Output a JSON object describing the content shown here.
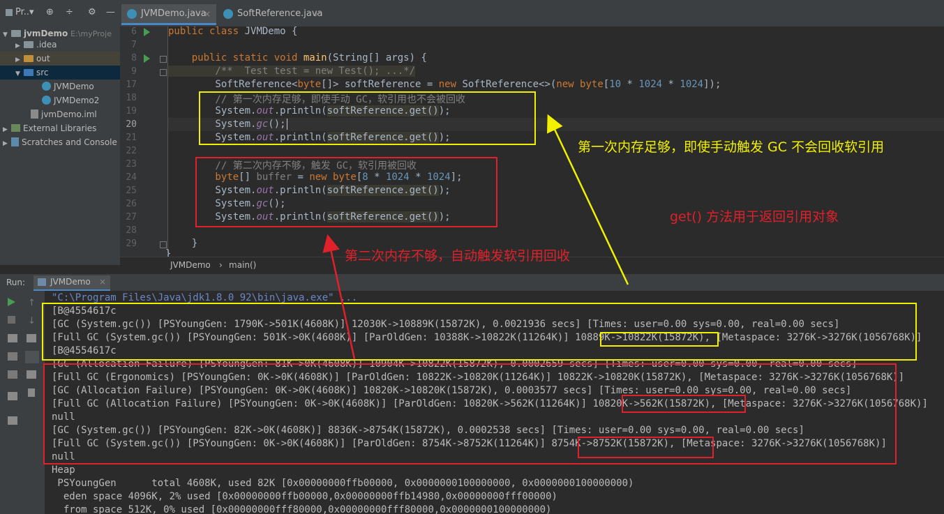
{
  "toolbar": {
    "project_label": "Pr..▾",
    "tools": [
      "⊕",
      "÷",
      "⚙",
      "—"
    ]
  },
  "tabs": [
    {
      "label": "JVMDemo.java",
      "close": "×",
      "active": true
    },
    {
      "label": "SoftReference.java",
      "close": "×",
      "active": false
    }
  ],
  "project_tree": {
    "root": {
      "name": "jvmDemo",
      "path": "E:\\myProje"
    },
    "items": [
      "jvmDemo",
      ".idea",
      "out",
      "src",
      "JVMDemo",
      "JVMDemo2",
      "jvmDemo.iml",
      "External Libraries",
      "Scratches and Console"
    ]
  },
  "gutter": {
    "line_numbers": [
      "6",
      "7",
      "8",
      "9",
      "17",
      "18",
      "19",
      "20",
      "21",
      "22",
      "23",
      "24",
      "25",
      "26",
      "27",
      "28",
      "29"
    ]
  },
  "code": {
    "l6a": "public class",
    "l6b": " JVMDemo {",
    "l8a": "    public static void",
    "l8b": " main",
    "l8c": "(String[] args) {",
    "l9": "        /**  Test test = new Test(); ...*/",
    "l17a": "        SoftReference<",
    "l17b": "byte",
    "l17c": "[]> softReference = ",
    "l17d": "new",
    "l17e": " SoftReference<>(",
    "l17f": "new",
    "l17g": " byte",
    "l17h": "[",
    "l17i": "10",
    "l17j": " * ",
    "l17k": "1024",
    "l17l": " * ",
    "l17m": "1024",
    "l17n": "]);",
    "l18": "        // 第一次内存足够，即使手动 GC，软引用也不会被回收",
    "sys": "        System.",
    "out": "out",
    "println": ".println(",
    "softget": "softReference.get()",
    "endcall": ");",
    "gc": "gc",
    "gcend": "();",
    "l23": "        // 第二次内存不够，触发 GC，软引用被回收",
    "l24a": "        byte",
    "l24b": "[] ",
    "l24c": "buffer",
    "l24d": " = ",
    "l24e": "new",
    "l24f": " byte",
    "l24g": "[",
    "l24h": "8",
    "l24i": " * ",
    "l24j": "1024",
    "l24k": " * ",
    "l24l": "1024",
    "l24m": "];",
    "l29": "    }",
    "l30": "}"
  },
  "breadcrumb": {
    "items": [
      "JVMDemo",
      "›",
      "main()"
    ]
  },
  "run": {
    "label": "Run:",
    "tab": "JVMDemo",
    "tab_close": "×"
  },
  "console": {
    "lines": [
      "\"C:\\Program Files\\Java\\jdk1.8.0_92\\bin\\java.exe\" ...",
      "[B@4554617c",
      "[GC (System.gc()) [PSYoungGen: 1790K->501K(4608K)] 12030K->10889K(15872K), 0.0021936 secs] [Times: user=0.00 sys=0.00, real=0.00 secs]",
      "[Full GC (System.gc()) [PSYoungGen: 501K->0K(4608K)] [ParOldGen: 10388K->10822K(11264K)] 10889K->10822K(15872K), [Metaspace: 3276K->3276K(1056768K)]",
      "[B@4554617c",
      "[GC (Allocation Failure) [PSYoungGen: 81K->0K(4608K)] 10904K->10822K(15872K), 0.0002659 secs] [Times: user=0.00 sys=0.00, real=0.00 secs]",
      "[Full GC (Ergonomics) [PSYoungGen: 0K->0K(4608K)] [ParOldGen: 10822K->10820K(11264K)] 10822K->10820K(15872K), [Metaspace: 3276K->3276K(1056768K)]",
      "[GC (Allocation Failure) [PSYoungGen: 0K->0K(4608K)] 10820K->10820K(15872K), 0.0003577 secs] [Times: user=0.00 sys=0.00, real=0.00 secs]",
      "[Full GC (Allocation Failure) [PSYoungGen: 0K->0K(4608K)] [ParOldGen: 10820K->562K(11264K)] 10820K->562K(15872K), [Metaspace: 3276K->3276K(1056768K)]",
      "null",
      "[GC (System.gc()) [PSYoungGen: 82K->0K(4608K)] 8836K->8754K(15872K), 0.0002538 secs] [Times: user=0.00 sys=0.00, real=0.00 secs]",
      "[Full GC (System.gc()) [PSYoungGen: 0K->0K(4608K)] [ParOldGen: 8754K->8752K(11264K)] 8754K->8752K(15872K), [Metaspace: 3276K->3276K(1056768K)]",
      "null",
      "Heap",
      " PSYoungGen      total 4608K, used 82K [0x00000000ffb00000, 0x0000000100000000, 0x0000000100000000)",
      "  eden space 4096K, 2% used [0x00000000ffb00000,0x00000000ffb14980,0x00000000fff00000)",
      "  from space 512K, 0% used [0x00000000fff80000,0x00000000fff80000,0x0000000100000000)"
    ]
  },
  "annotations": {
    "first": "第一次内存足够，即使手动触发 GC 不会回收软引用",
    "get": "get() 方法用于返回引用对象",
    "second": "第二次内存不够，自动触发软引用回收"
  },
  "colors": {
    "yellow": "#f0f000",
    "red": "#e0202a",
    "accent": "#4a88c7"
  }
}
